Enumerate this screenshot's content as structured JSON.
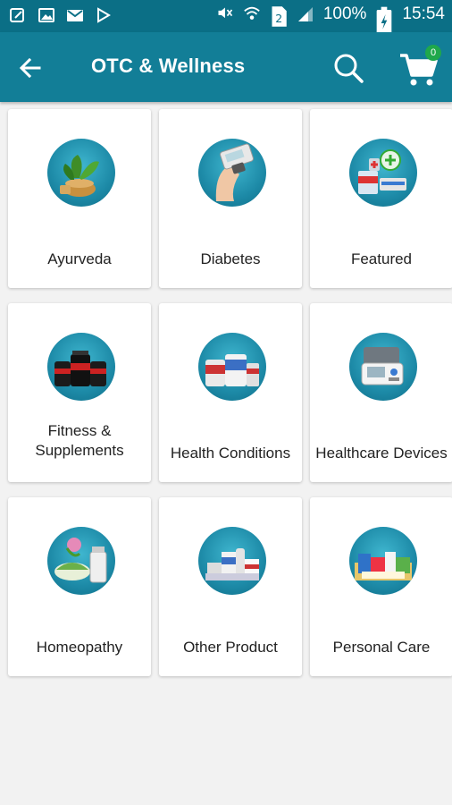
{
  "status_bar": {
    "battery_text": "100%",
    "time": "15:54"
  },
  "toolbar": {
    "title": "OTC & Wellness",
    "cart_count": "0"
  },
  "categories": [
    {
      "label": "Ayurveda",
      "icon": "ayurveda-icon"
    },
    {
      "label": "Diabetes",
      "icon": "diabetes-icon"
    },
    {
      "label": "Featured",
      "icon": "featured-icon"
    },
    {
      "label": "Fitness &\nSupplements",
      "icon": "fitness-icon"
    },
    {
      "label": "Health Conditions",
      "icon": "health-conditions-icon"
    },
    {
      "label": "Healthcare Devices",
      "icon": "healthcare-devices-icon"
    },
    {
      "label": "Homeopathy",
      "icon": "homeopathy-icon"
    },
    {
      "label": "Other Product",
      "icon": "other-product-icon"
    },
    {
      "label": "Personal Care",
      "icon": "personal-care-icon"
    }
  ],
  "colors": {
    "status_bar": "#0b6f86",
    "toolbar": "#127e97",
    "badge": "#1fa84b",
    "background": "#f2f2f2"
  }
}
